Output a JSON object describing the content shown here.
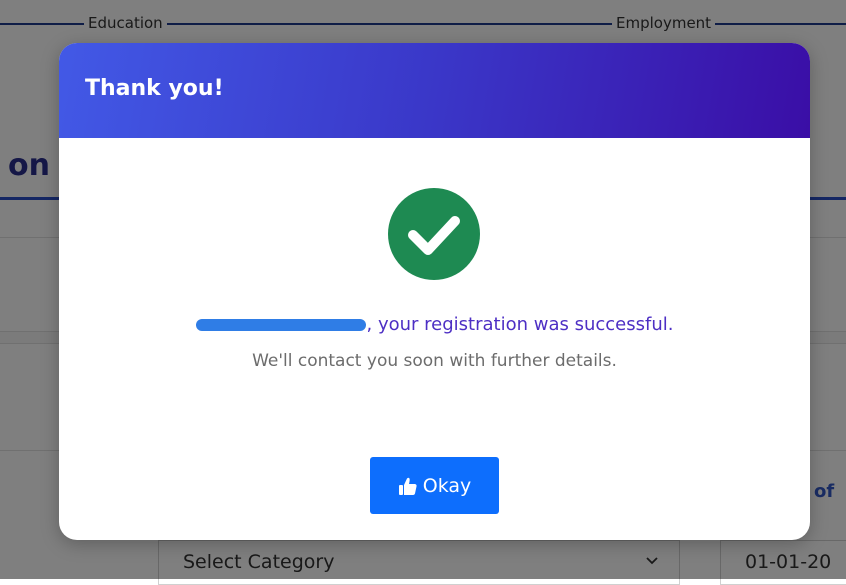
{
  "stepper": {
    "steps": [
      {
        "label": "Education"
      },
      {
        "label": "Employment"
      }
    ]
  },
  "background": {
    "section_title": "on",
    "right_link": "of",
    "category_select": {
      "value": "Select Category",
      "chevron": "chevron-down-icon"
    },
    "date_field": {
      "value": "01-01-20"
    }
  },
  "modal": {
    "title": "Thank you!",
    "icon": "check-circle-icon",
    "icon_color": "#1e8a52",
    "header_gradient": [
      "#4259e6",
      "#3a0ea6"
    ],
    "message_suffix": ", your registration was successful.",
    "message_detail": "We'll contact you soon with further details.",
    "okay_button": {
      "label": "Okay",
      "icon": "thumbs-up-icon",
      "color": "#0d6efd"
    }
  }
}
